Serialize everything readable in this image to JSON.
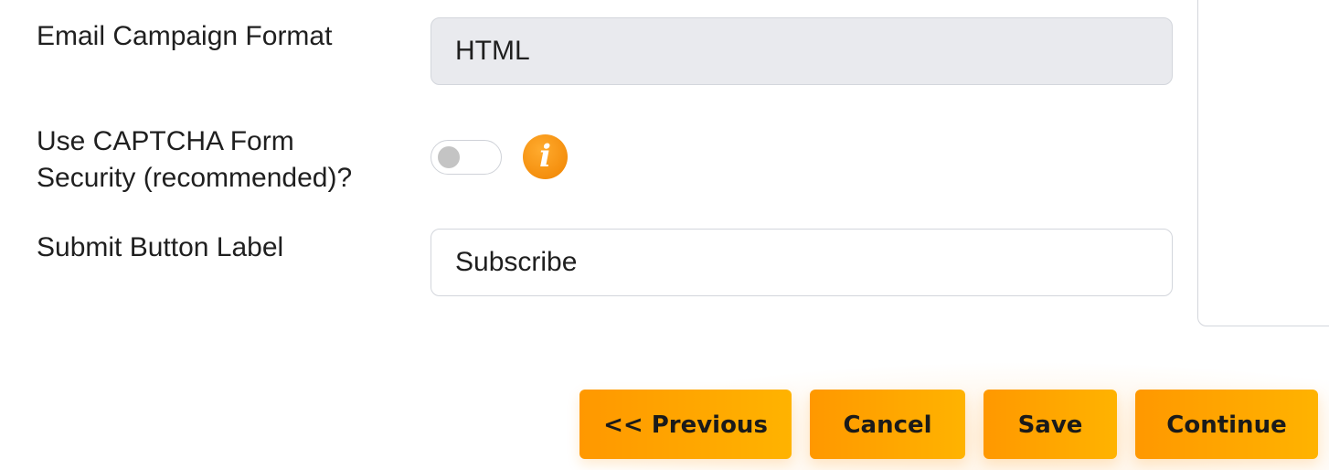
{
  "form": {
    "email_format": {
      "label": "Email Campaign Format",
      "value": "HTML"
    },
    "captcha": {
      "label_line1": "Use CAPTCHA Form",
      "label_line2": "Security (recommended)?",
      "enabled": false,
      "info_glyph": "i"
    },
    "submit_label": {
      "label": "Submit Button Label",
      "value": "Subscribe"
    }
  },
  "actions": {
    "previous": "<< Previous",
    "cancel": "Cancel",
    "save": "Save",
    "continue": "Continue"
  },
  "colors": {
    "accent_start": "#ff9800",
    "accent_end": "#ffb300",
    "info_icon": "#f08300",
    "disabled_field_bg": "#e9eaee"
  },
  "icons": {
    "info": "info-icon"
  }
}
